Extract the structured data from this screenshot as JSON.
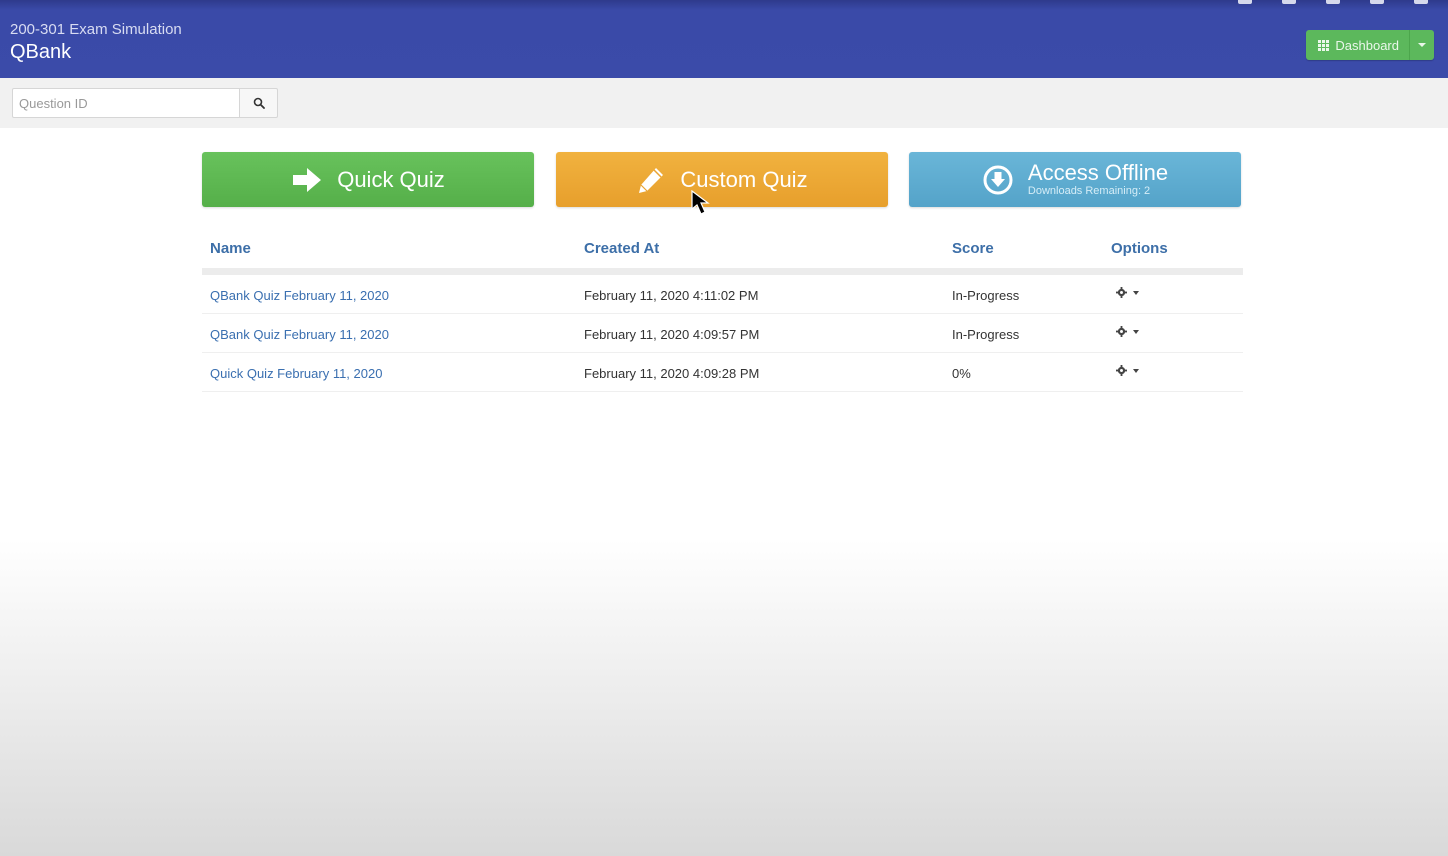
{
  "header": {
    "subtitle": "200-301 Exam Simulation",
    "title": "QBank",
    "dashboard_label": "Dashboard",
    "icons": [
      "pause-icon",
      "monitor-icon",
      "user-icon",
      "phone-icon",
      "lock-icon"
    ]
  },
  "search": {
    "placeholder": "Question ID",
    "value": "",
    "button_icon": "search-icon"
  },
  "actions": {
    "quick_quiz": {
      "label": "Quick Quiz",
      "icon": "arrow-right-icon",
      "color": "#5cb85c"
    },
    "custom_quiz": {
      "label": "Custom Quiz",
      "icon": "pencil-icon",
      "color": "#f0ad4e"
    },
    "access_offline": {
      "label": "Access Offline",
      "sublabel": "Downloads Remaining: 2",
      "icon": "download-circle-icon",
      "color": "#5bc0de"
    }
  },
  "table": {
    "columns": [
      "Name",
      "Created At",
      "Score",
      "Options"
    ],
    "rows": [
      {
        "name": "QBank Quiz February 11, 2020",
        "created_at": "February 11, 2020 4:11:02 PM",
        "score": "In-Progress"
      },
      {
        "name": "QBank Quiz February 11, 2020",
        "created_at": "February 11, 2020 4:09:57 PM",
        "score": "In-Progress"
      },
      {
        "name": "Quick Quiz February 11, 2020",
        "created_at": "February 11, 2020 4:09:28 PM",
        "score": "0%"
      }
    ]
  },
  "colors": {
    "header_bg": "#3b4ba9",
    "link": "#3a6fb0",
    "column_header": "#3d6fa8"
  }
}
